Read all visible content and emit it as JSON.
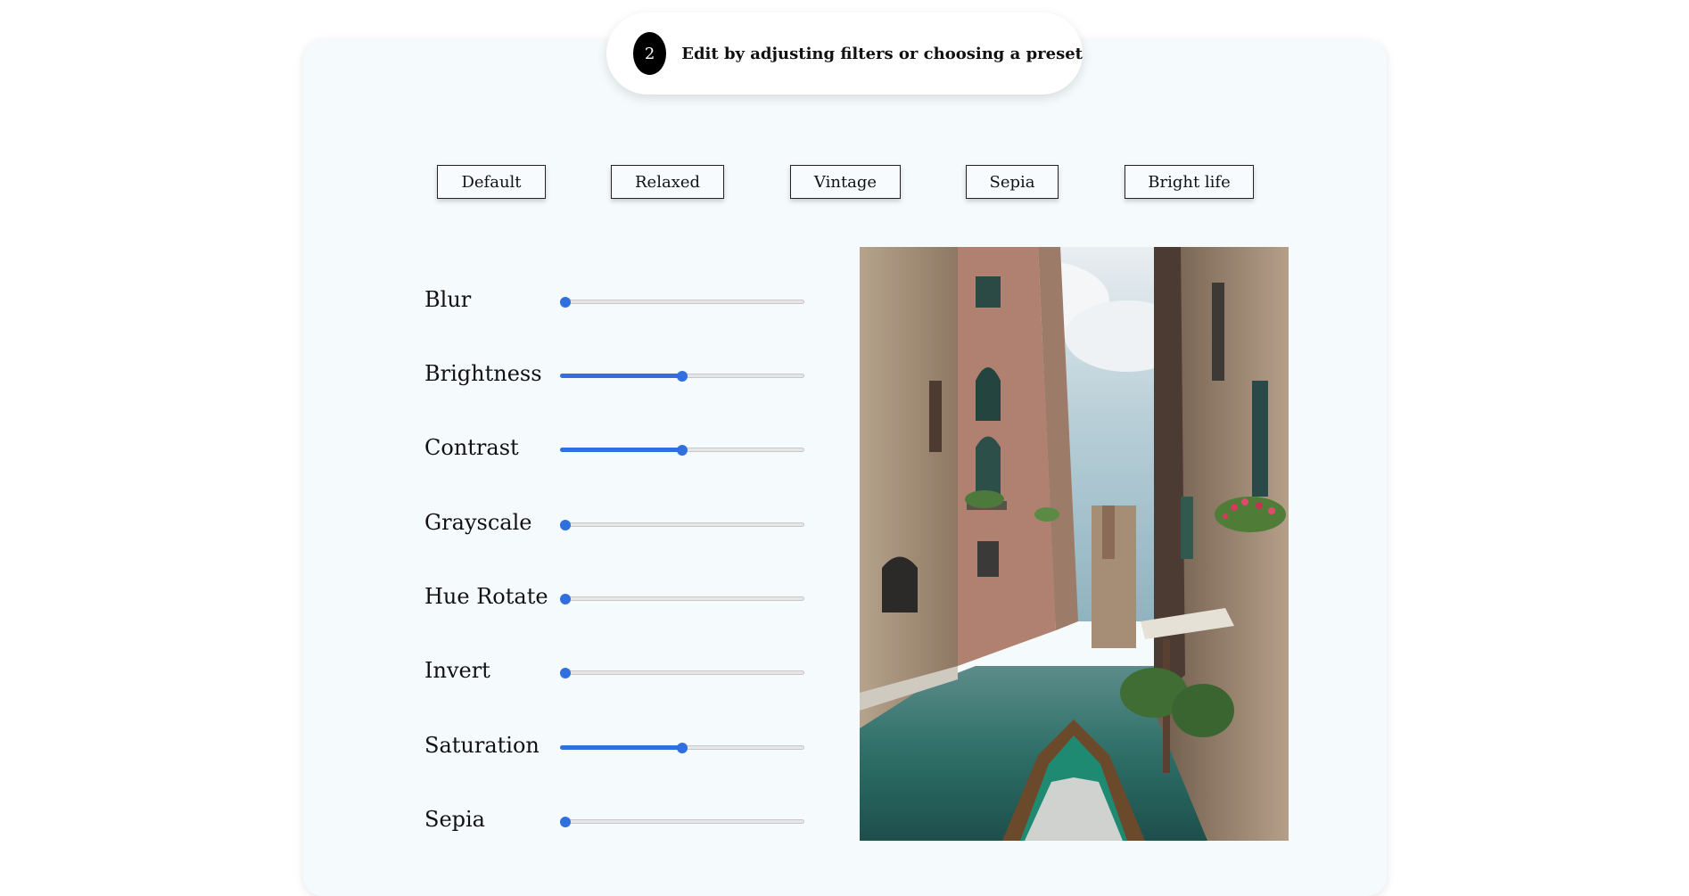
{
  "step": {
    "number": "2",
    "instruction": "Edit by adjusting filters or choosing a preset"
  },
  "presets": [
    {
      "label": "Default"
    },
    {
      "label": "Relaxed"
    },
    {
      "label": "Vintage"
    },
    {
      "label": "Sepia"
    },
    {
      "label": "Bright life"
    }
  ],
  "filters": [
    {
      "label": "Blur",
      "level": 0
    },
    {
      "label": "Brightness",
      "level": 0.5
    },
    {
      "label": "Contrast",
      "level": 0.5
    },
    {
      "label": "Grayscale",
      "level": 0
    },
    {
      "label": "Hue Rotate",
      "level": 0
    },
    {
      "label": "Invert",
      "level": 0
    },
    {
      "label": "Saturation",
      "level": 0.5
    },
    {
      "label": "Sepia",
      "level": 0
    }
  ],
  "colors": {
    "accent": "#2f6fde",
    "card_background": "#f5fafc",
    "step_badge": "#000000"
  },
  "icons": {
    "step_badge": "circle-number-icon"
  }
}
